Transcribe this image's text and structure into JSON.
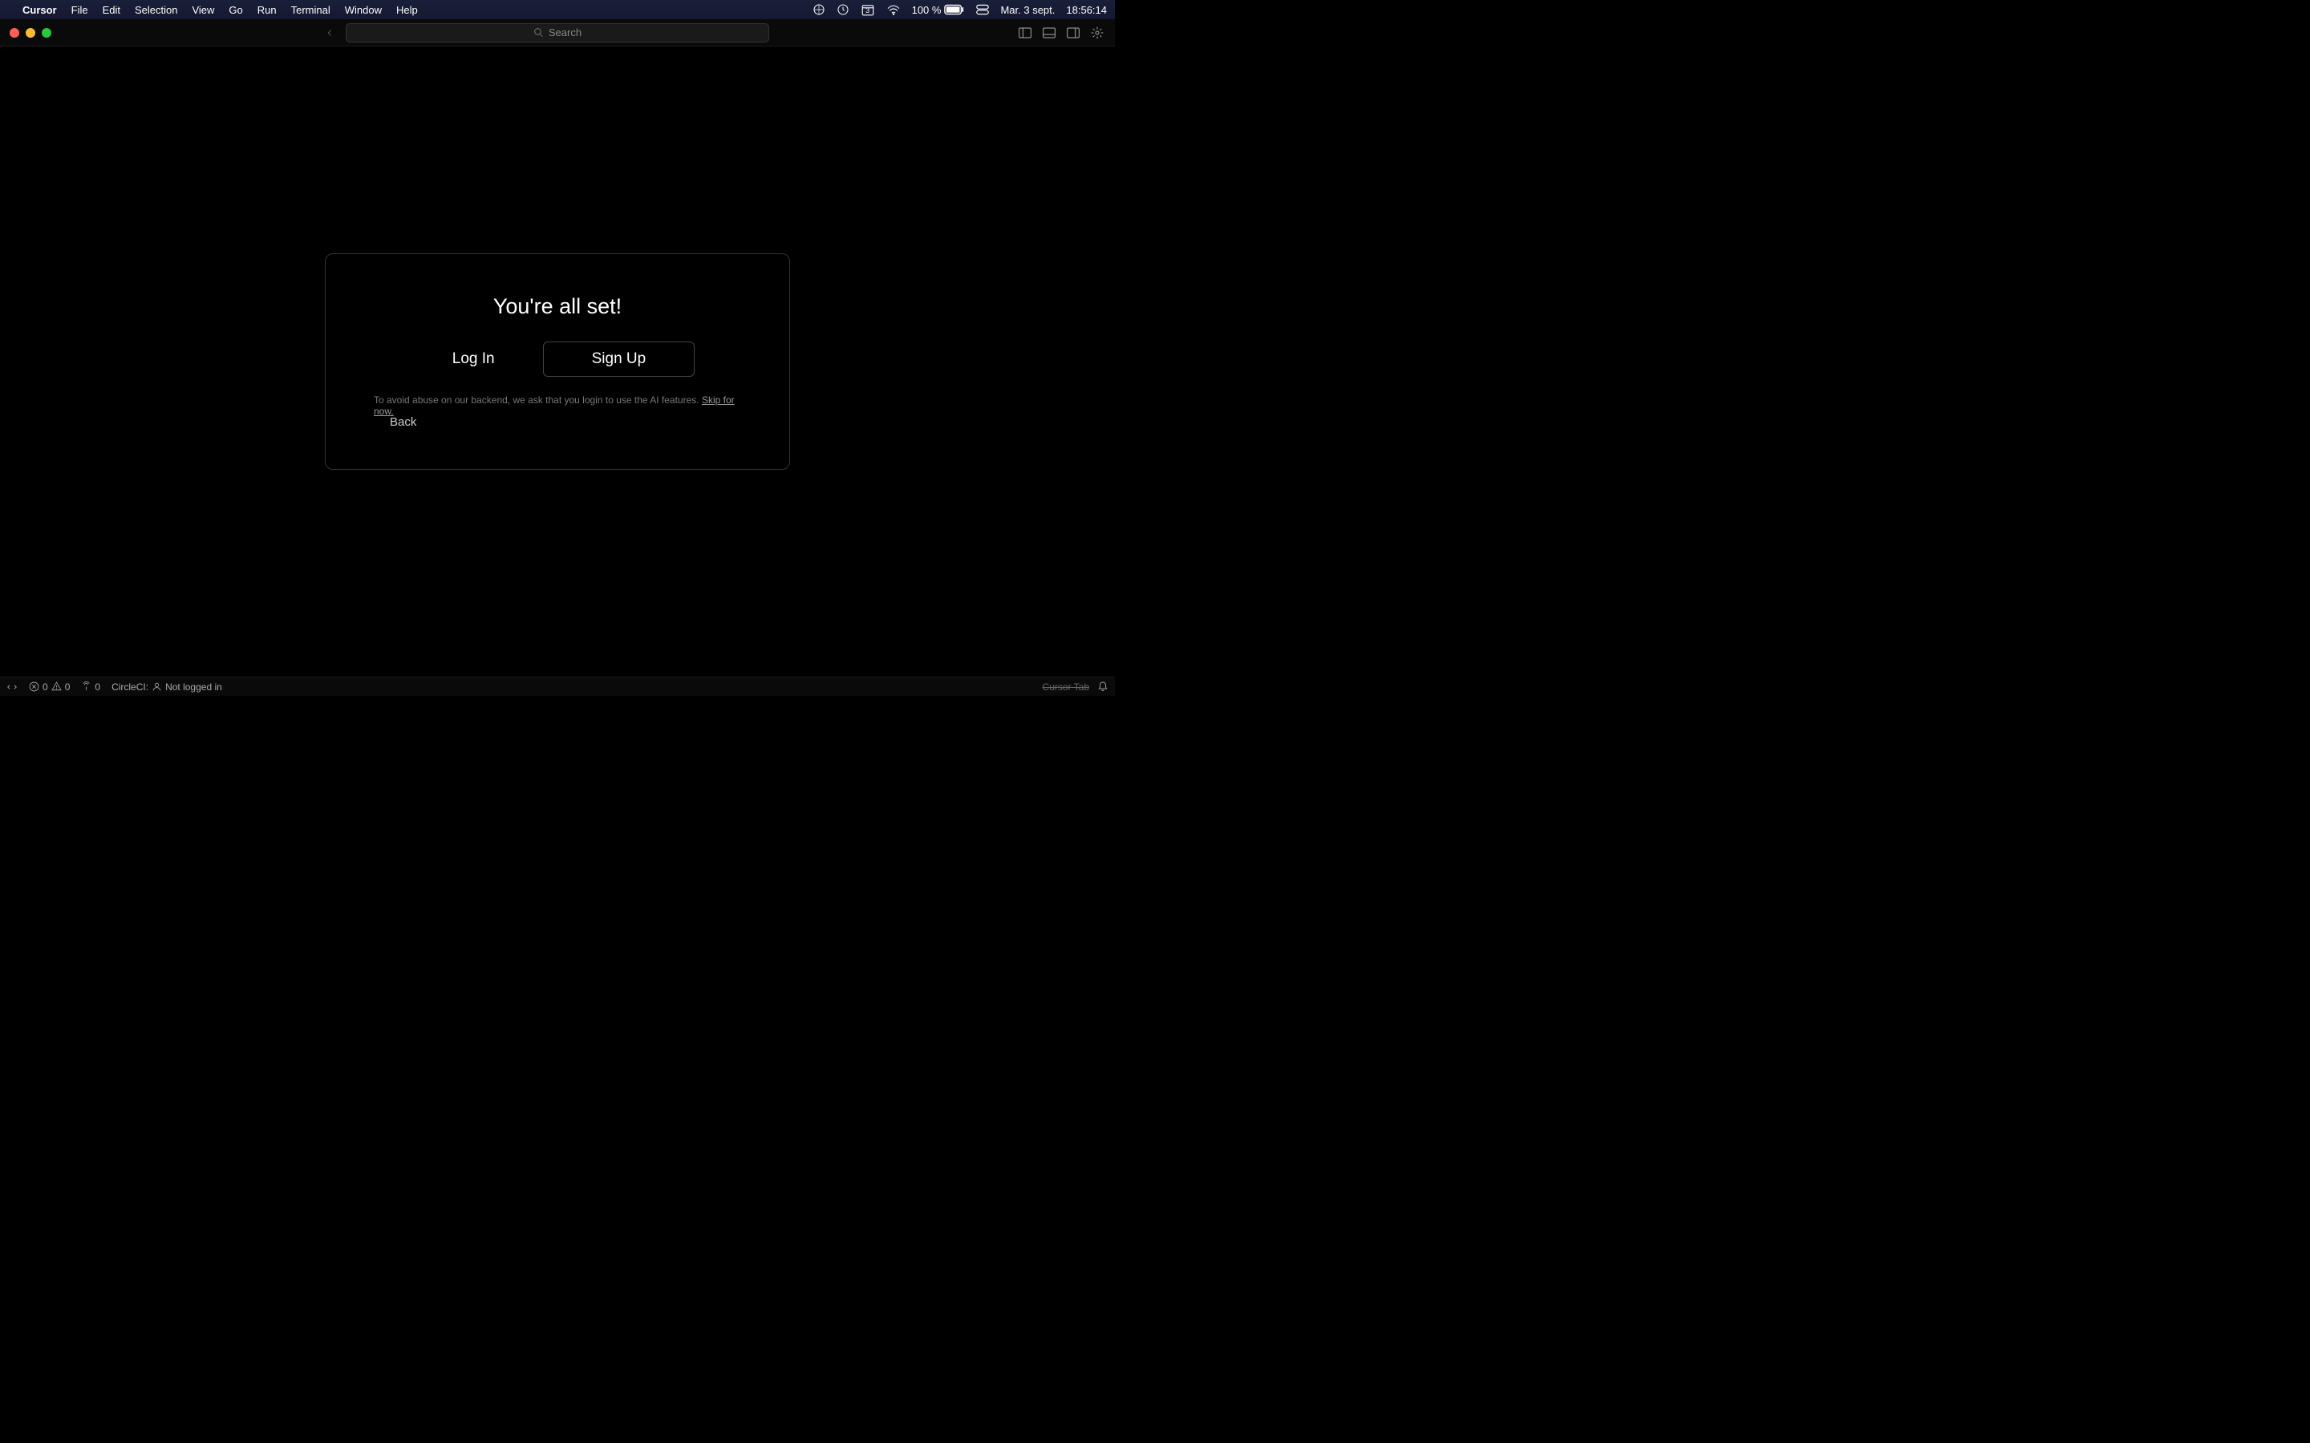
{
  "menubar": {
    "app_name": "Cursor",
    "items": [
      "File",
      "Edit",
      "Selection",
      "View",
      "Go",
      "Run",
      "Terminal",
      "Window",
      "Help"
    ],
    "battery_percent": "100 %",
    "date": "Mar. 3 sept.",
    "time": "18:56:14",
    "calendar_day": "3"
  },
  "toolbar": {
    "search_placeholder": "Search"
  },
  "welcome": {
    "title": "You're all set!",
    "login_label": "Log In",
    "signup_label": "Sign Up",
    "info_prefix": "To avoid abuse on our backend, we ask that you login to use the AI features. ",
    "skip_label": "Skip for now.",
    "back_label": "Back"
  },
  "statusbar": {
    "errors": "0",
    "warnings": "0",
    "ports": "0",
    "circleci_label": "CircleCI:",
    "circleci_status": "Not logged in",
    "cursor_tab": "Cursor Tab"
  }
}
